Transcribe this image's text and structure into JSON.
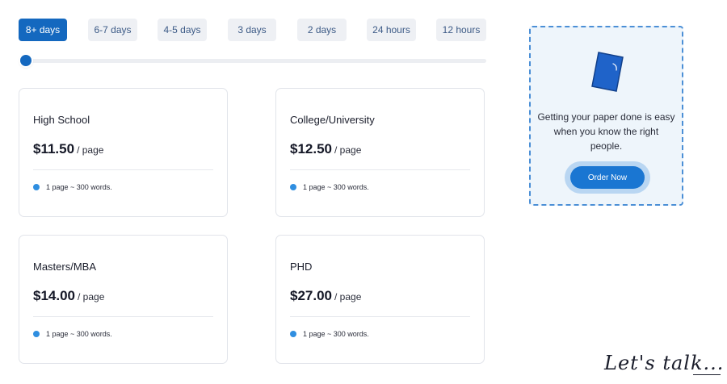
{
  "delivery_tabs": [
    {
      "label": "8+ days",
      "active": true
    },
    {
      "label": "6-7 days",
      "active": false
    },
    {
      "label": "4-5 days",
      "active": false
    },
    {
      "label": "3 days",
      "active": false
    },
    {
      "label": "2 days",
      "active": false
    },
    {
      "label": "24 hours",
      "active": false
    },
    {
      "label": "12 hours",
      "active": false
    }
  ],
  "slider": {
    "value_fraction": 0
  },
  "pricing_cards": [
    {
      "level": "High School",
      "price": "$11.50",
      "unit": "/ page",
      "note": "1 page ~ 300 words."
    },
    {
      "level": "College/University",
      "price": "$12.50",
      "unit": "/ page",
      "note": "1 page ~ 300 words."
    },
    {
      "level": "Masters/MBA",
      "price": "$14.00",
      "unit": "/ page",
      "note": "1 page ~ 300 words."
    },
    {
      "level": "PHD",
      "price": "$27.00",
      "unit": "/ page",
      "note": "1 page ~ 300 words."
    }
  ],
  "promo": {
    "icon": "paper-document-icon",
    "text": "Getting your paper done is easy when you know the right people.",
    "button_label": "Order Now"
  },
  "signature": {
    "text": "Let's talk..."
  },
  "colors": {
    "accent": "#1468bf",
    "tab_bg": "#eef0f4",
    "promo_border": "#4b8fd6",
    "note_dot": "#2f8ee0"
  }
}
